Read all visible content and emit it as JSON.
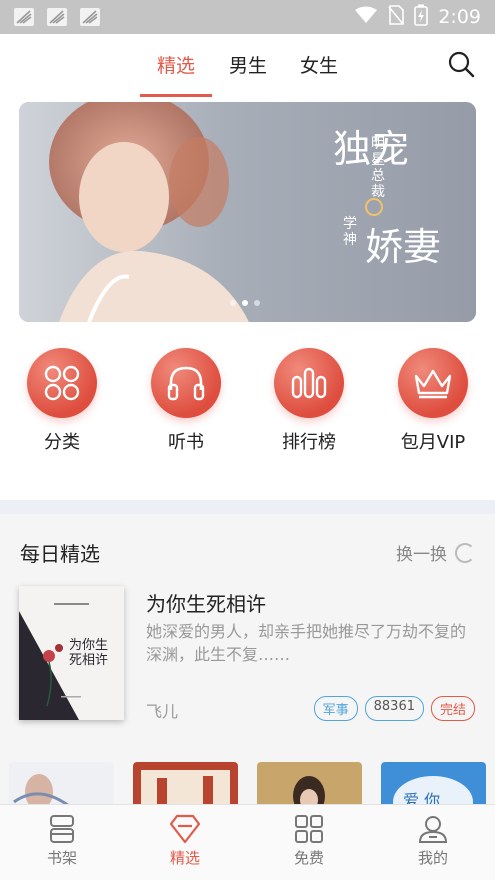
{
  "status_bar": {
    "time": "2:09"
  },
  "top_tabs": [
    {
      "label": "精选",
      "active": true
    },
    {
      "label": "男生",
      "active": false
    },
    {
      "label": "女生",
      "active": false
    }
  ],
  "banner": {
    "title_main": "独宠",
    "title_sub": "娇妻",
    "vertical_text_1": "明星总裁",
    "vertical_text_2": "学神",
    "page_count": 3,
    "active_page": 2
  },
  "categories": [
    {
      "label": "分类",
      "icon": "category-grid-icon"
    },
    {
      "label": "听书",
      "icon": "headphones-icon"
    },
    {
      "label": "排行榜",
      "icon": "ranking-bars-icon"
    },
    {
      "label": "包月VIP",
      "icon": "crown-icon"
    }
  ],
  "daily": {
    "title": "每日精选",
    "refresh_label": "换一换",
    "book": {
      "title": "为你生死相许",
      "description": "她深爱的男人，却亲手把她推尽了万劫不复的深渊，此生不复……",
      "author": "飞儿",
      "cover_text": "为你生死相许",
      "tags": [
        "军事",
        "88361",
        "完结"
      ]
    }
  },
  "bottom_nav": [
    {
      "label": "书架",
      "icon": "bookshelf-icon",
      "active": false
    },
    {
      "label": "精选",
      "icon": "diamond-icon",
      "active": true
    },
    {
      "label": "免费",
      "icon": "grid-apps-icon",
      "active": false
    },
    {
      "label": "我的",
      "icon": "user-icon",
      "active": false
    }
  ],
  "colors": {
    "accent": "#e25a4a",
    "tag_blue": "#4fa5dc"
  }
}
